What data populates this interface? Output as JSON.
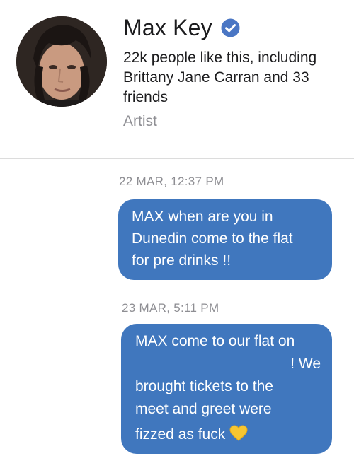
{
  "profile": {
    "name": "Max Key",
    "likes_text": "22k people like this, including Brittany Jane Carran and 33 friends",
    "category": "Artist"
  },
  "messages": [
    {
      "timestamp": "22 MAR, 12:37 PM",
      "lines": [
        "MAX when are you in",
        "Dunedin come to the flat",
        "for pre drinks !!"
      ]
    },
    {
      "timestamp": "23 MAR, 5:11 PM",
      "lines": [
        "MAX come to our flat on",
        "! We",
        "brought tickets to the",
        "meet and greet were",
        "fizzed as fuck"
      ],
      "emoji": "yellow-heart"
    }
  ],
  "colors": {
    "bubble": "#4077be",
    "verified": "#4a76c4",
    "muted": "#8e8e93"
  }
}
